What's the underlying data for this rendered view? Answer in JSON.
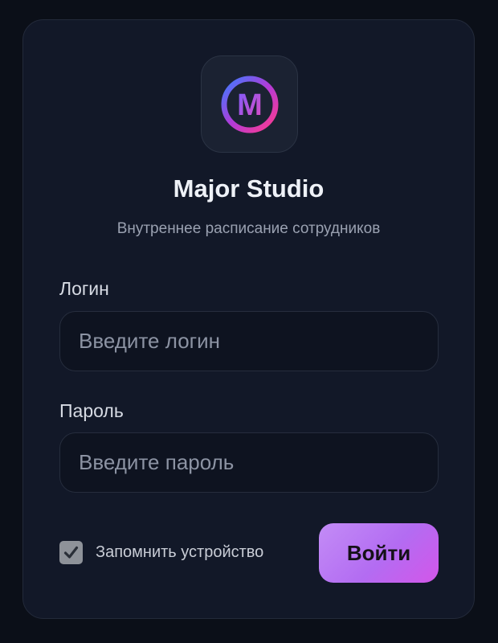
{
  "app": {
    "name": "Major Studio",
    "subtitle": "Внутреннее расписание сотрудников",
    "logo_letter": "M",
    "logo_gradient": [
      "#3b6cff",
      "#b23bd8",
      "#ff3b8c"
    ]
  },
  "form": {
    "login_label": "Логин",
    "login_placeholder": "Введите логин",
    "password_label": "Пароль",
    "password_placeholder": "Введите пароль",
    "remember_label": "Запомнить устройство",
    "remember_checked": true,
    "submit_label": "Войти"
  },
  "icons": {
    "logo": "logo-icon",
    "checkbox": "checkmark-icon"
  },
  "colors": {
    "background": "#0b0f18",
    "card": "#121828",
    "accent_start": "#c38cf6",
    "accent_end": "#d356e9"
  }
}
